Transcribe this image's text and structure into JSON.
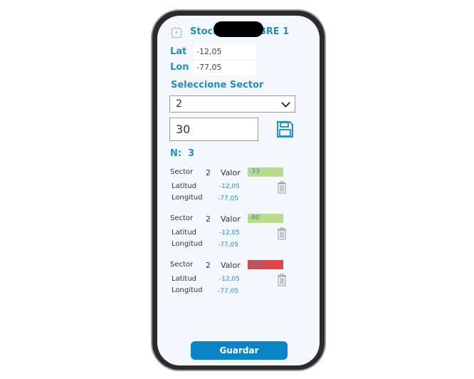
{
  "header": {
    "title": "Stock BANCOBRE 1",
    "back_icon": "chevron-left-icon"
  },
  "location": {
    "lat_label": "Lat",
    "lat_value": "-12,05",
    "lon_label": "Lon",
    "lon_value": "-77,05"
  },
  "sector_select": {
    "label": "Seleccione Sector",
    "selected": "2"
  },
  "value_input": {
    "value": "30"
  },
  "count": {
    "label": "N:",
    "value": "3"
  },
  "records": [
    {
      "sector_label": "Sector",
      "sector": "2",
      "valor_label": "Valor",
      "valor": "-33",
      "color": "#b9dc8c",
      "lat_label": "Latitud",
      "lat": "-12,05",
      "lon_label": "Longitud",
      "lon": "-77,05"
    },
    {
      "sector_label": "Sector",
      "sector": "2",
      "valor_label": "Valor",
      "valor": "-80",
      "color": "#b9dc8c",
      "lat_label": "Latitud",
      "lat": "-12,05",
      "lon_label": "Longitud",
      "lon": "-77,05"
    },
    {
      "sector_label": "Sector",
      "sector": "2",
      "valor_label": "Valor",
      "valor": "-100",
      "color": "#e04444",
      "lat_label": "Latitud",
      "lat": "-12,05",
      "lon_label": "Longitud",
      "lon": "-77,05"
    }
  ],
  "footer": {
    "save_label": "Guardar"
  },
  "colors": {
    "accent": "#1f8fc4",
    "button": "#0a84c6"
  }
}
